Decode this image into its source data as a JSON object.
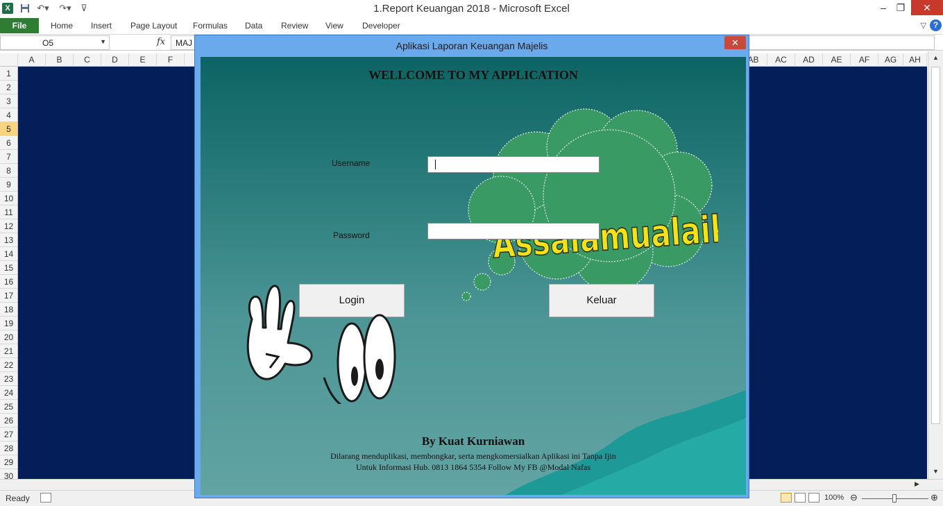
{
  "window": {
    "title": "1.Report Keuangan 2018  -  Microsoft Excel",
    "app_icon": "X",
    "qat_icons": [
      "save-icon",
      "undo-icon",
      "redo-icon",
      "customize-qat-icon"
    ],
    "controls": {
      "minimize": "–",
      "restore": "❐",
      "close": "✕"
    }
  },
  "ribbon": {
    "file": "File",
    "tabs": [
      "Home",
      "Insert",
      "Page Layout",
      "Formulas",
      "Data",
      "Review",
      "View",
      "Developer"
    ],
    "help_icon": "?"
  },
  "formula_bar": {
    "name_box": "O5",
    "fx": "fx",
    "value": "MAJ"
  },
  "columns_left": [
    "A",
    "B",
    "C",
    "D",
    "E",
    "F"
  ],
  "columns_right": [
    "AB",
    "AC",
    "AD",
    "AE",
    "AF",
    "AG",
    "AH"
  ],
  "rows": [
    "1",
    "2",
    "3",
    "4",
    "5",
    "6",
    "7",
    "8",
    "9",
    "10",
    "11",
    "12",
    "13",
    "14",
    "15",
    "16",
    "17",
    "18",
    "19",
    "20",
    "21",
    "22",
    "23",
    "24",
    "25",
    "26",
    "27",
    "28",
    "29",
    "30"
  ],
  "active_row": "5",
  "status": {
    "ready": "Ready",
    "zoom": "100%"
  },
  "dialog": {
    "title": "Aplikasi Laporan Keuangan Majelis",
    "close": "✕",
    "welcome": "WELLCOME TO MY APPLICATION",
    "username_label": "Username",
    "password_label": "Password",
    "username_value": "",
    "password_value": "",
    "login_button": "Login",
    "exit_button": "Keluar",
    "cloud_text": "Assalamualaikum",
    "author": "By Kuat Kurniawan",
    "footer_line1": "Dilarang menduplikasi, membongkar, serta mengkomersialkan Aplikasi ini Tanpa Ijin",
    "footer_line2": "Untuk Informasi Hub. 0813 1864 5354 Follow My FB @Modal Nafas"
  },
  "colors": {
    "sheet_background": "#041e5a",
    "dialog_frame": "#6aa9ec",
    "file_tab": "#2e7d32",
    "cloud": "#3a9a64",
    "wordart": "#f2e21a"
  }
}
